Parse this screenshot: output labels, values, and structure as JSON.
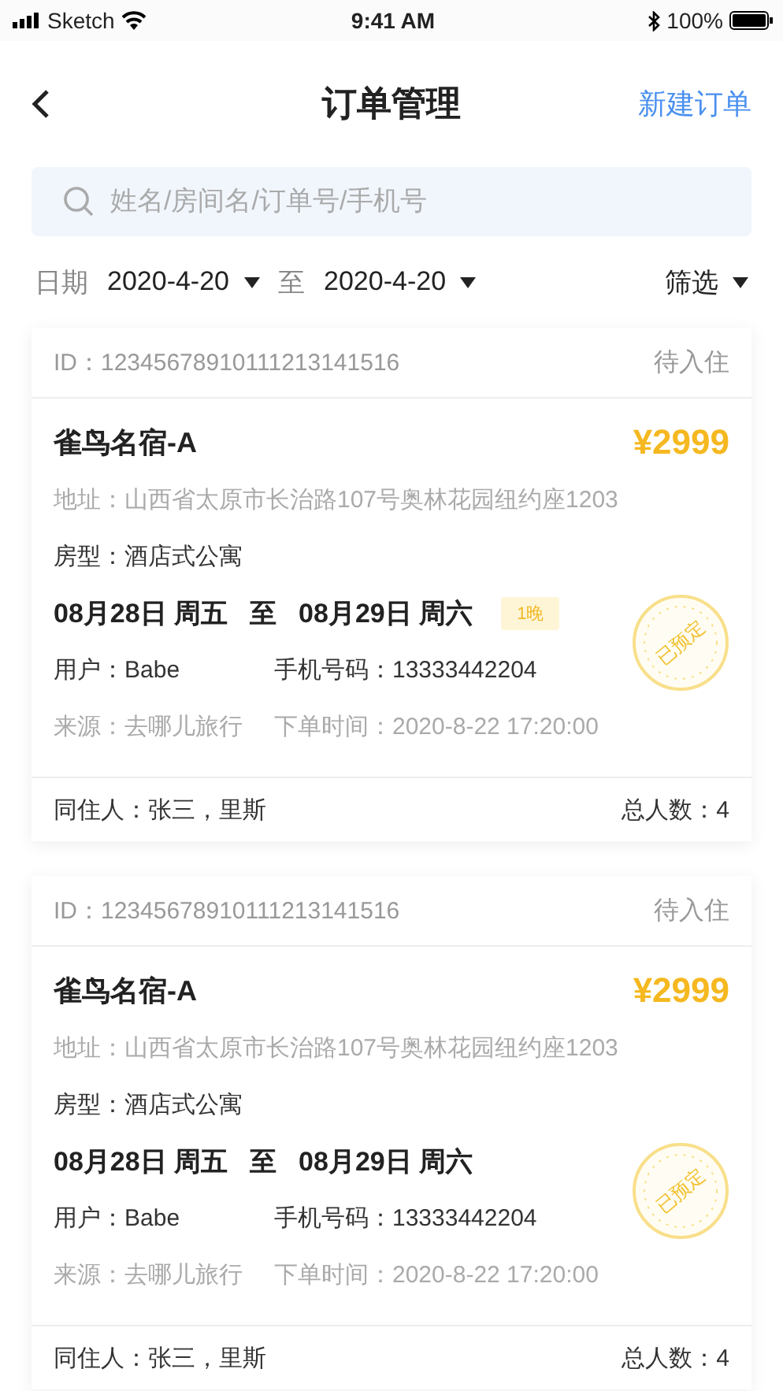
{
  "status_bar": {
    "carrier": "Sketch",
    "time": "9:41 AM",
    "battery": "100%"
  },
  "header": {
    "title": "订单管理",
    "action": "新建订单"
  },
  "search": {
    "placeholder": "姓名/房间名/订单号/手机号"
  },
  "filter": {
    "label": "日期",
    "from": "2020-4-20",
    "separator": "至",
    "to": "2020-4-20",
    "filter_button": "筛选"
  },
  "orders": [
    {
      "id": "ID：12345678910111213141516",
      "status": "待入住",
      "name": "雀鸟名宿-A",
      "price": "¥2999",
      "address": "地址：山西省太原市长治路107号奥林花园纽约座1203",
      "room_type": "房型：酒店式公寓",
      "check_in": "08月28日 周五",
      "to": "至",
      "check_out": "08月29日 周六",
      "nights": "1晚",
      "user": "用户：Babe",
      "phone": "手机号码：13333442204",
      "source": "来源：去哪儿旅行",
      "order_time": "下单时间：2020-8-22 17:20:00",
      "stamp": "已预定",
      "cohabitants": "同住人：张三，里斯",
      "total": "总人数：4"
    },
    {
      "id": "ID：12345678910111213141516",
      "status": "待入住",
      "name": "雀鸟名宿-A",
      "price": "¥2999",
      "address": "地址：山西省太原市长治路107号奥林花园纽约座1203",
      "room_type": "房型：酒店式公寓",
      "check_in": "08月28日 周五",
      "to": "至",
      "check_out": "08月29日 周六",
      "user": "用户：Babe",
      "phone": "手机号码：13333442204",
      "source": "来源：去哪儿旅行",
      "order_time": "下单时间：2020-8-22 17:20:00",
      "stamp": "已预定",
      "cohabitants": "同住人：张三，里斯",
      "total": "总人数：4"
    }
  ]
}
